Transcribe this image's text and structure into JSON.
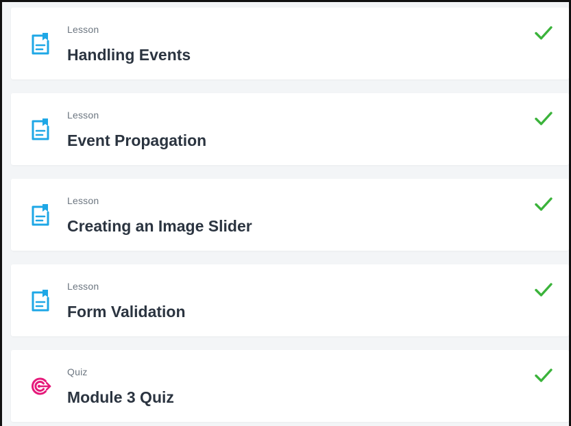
{
  "colors": {
    "lesson_icon": "#1ea7e6",
    "quiz_icon": "#e5197a",
    "check": "#3bb33b",
    "title": "#2b3440",
    "type_label": "#6c7680"
  },
  "items": [
    {
      "type": "Lesson",
      "title": "Handling Events",
      "icon": "lesson-document-icon",
      "status": "complete"
    },
    {
      "type": "Lesson",
      "title": "Event Propagation",
      "icon": "lesson-document-icon",
      "status": "complete"
    },
    {
      "type": "Lesson",
      "title": "Creating an Image Slider",
      "icon": "lesson-document-icon",
      "status": "complete"
    },
    {
      "type": "Lesson",
      "title": "Form Validation",
      "icon": "lesson-document-icon",
      "status": "complete"
    },
    {
      "type": "Quiz",
      "title": "Module 3 Quiz",
      "icon": "quiz-target-icon",
      "status": "complete"
    }
  ]
}
